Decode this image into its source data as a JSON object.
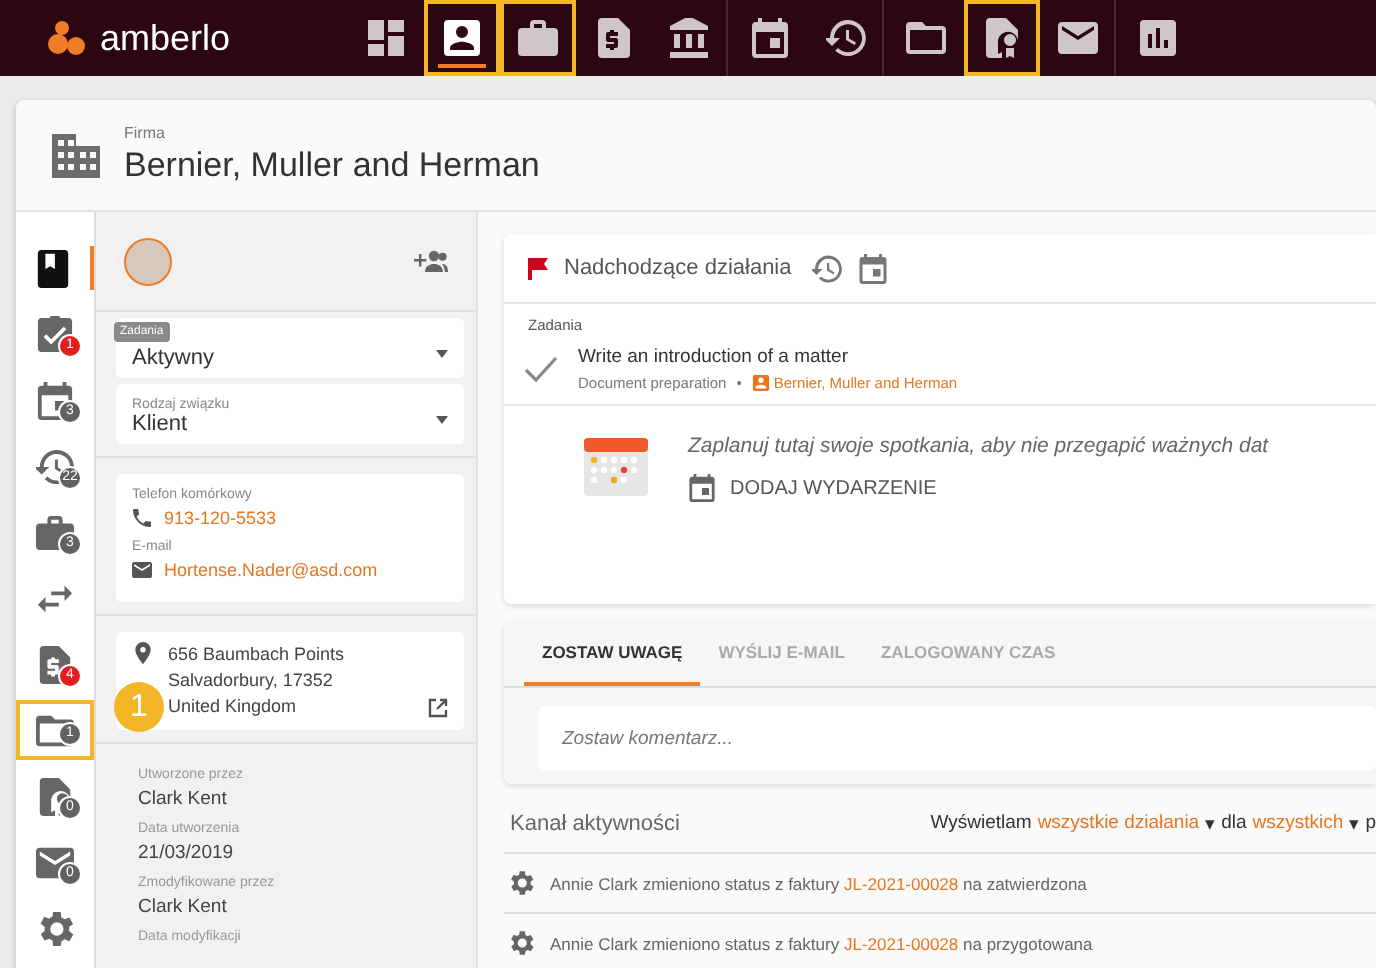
{
  "brand": {
    "name": "amberlo"
  },
  "nav": [
    {
      "kind": "dashboard",
      "selected": false,
      "highlighted": false,
      "divider": false
    },
    {
      "kind": "contact",
      "selected": true,
      "highlighted": true,
      "divider": false
    },
    {
      "kind": "briefcase",
      "selected": false,
      "highlighted": true,
      "divider": false
    },
    {
      "kind": "invoice",
      "selected": false,
      "highlighted": false,
      "divider": false
    },
    {
      "kind": "bank",
      "selected": false,
      "highlighted": false,
      "divider": true
    },
    {
      "kind": "calendar",
      "selected": false,
      "highlighted": false,
      "divider": false
    },
    {
      "kind": "time",
      "selected": false,
      "highlighted": false,
      "divider": true
    },
    {
      "kind": "folder",
      "selected": false,
      "highlighted": false,
      "divider": false
    },
    {
      "kind": "badge",
      "selected": false,
      "highlighted": true,
      "divider": false
    },
    {
      "kind": "mail",
      "selected": false,
      "highlighted": false,
      "divider": true
    },
    {
      "kind": "chart",
      "selected": false,
      "highlighted": false,
      "divider": false
    }
  ],
  "header": {
    "caption": "Firma",
    "title": "Bernier, Muller and Herman"
  },
  "rail": [
    {
      "kind": "book",
      "selected": true,
      "highlighted": false
    },
    {
      "kind": "task",
      "count": "1",
      "color": "#e02020",
      "selected": false,
      "highlighted": false
    },
    {
      "kind": "calendar",
      "count": "3",
      "color": "#616161",
      "selected": false,
      "highlighted": false
    },
    {
      "kind": "time",
      "count": "22",
      "color": "#616161",
      "selected": false,
      "highlighted": false
    },
    {
      "kind": "briefcase",
      "count": "3",
      "color": "#616161",
      "selected": false,
      "highlighted": false
    },
    {
      "kind": "swap",
      "selected": false,
      "highlighted": false
    },
    {
      "kind": "invoice",
      "count": "4",
      "color": "#e02020",
      "selected": false,
      "highlighted": false
    },
    {
      "kind": "folder",
      "count": "1",
      "color": "#616161",
      "selected": false,
      "highlighted": true,
      "step": "1"
    },
    {
      "kind": "badge",
      "count": "0",
      "color": "#616161",
      "selected": false,
      "highlighted": false
    },
    {
      "kind": "mail",
      "count": "0",
      "color": "#616161",
      "selected": false,
      "highlighted": false
    },
    {
      "kind": "gear",
      "selected": false,
      "highlighted": false
    }
  ],
  "details": {
    "tooltip": "Zadania",
    "selects": [
      {
        "value": "Aktywny"
      },
      {
        "label": "Rodzaj związku",
        "value": "Klient"
      }
    ],
    "contacts": [
      {
        "label": "Telefon komórkowy",
        "kind": "phone",
        "value": "913-120-5533"
      },
      {
        "label": "E-mail",
        "kind": "mail",
        "value": "Hortense.Nader@asd.com"
      }
    ],
    "address": [
      "656 Baumbach Points",
      "Salvadorbury, 17352",
      "United Kingdom"
    ],
    "meta": [
      {
        "label": "Utworzone przez",
        "value": "Clark Kent"
      },
      {
        "label": "Data utworzenia",
        "value": "21/03/2019"
      },
      {
        "label": "Zmodyfikowane przez",
        "value": "Clark Kent"
      },
      {
        "label": "Data modyfikacji"
      }
    ]
  },
  "upcoming": {
    "title": "Nadchodzące działania",
    "section": "Zadania",
    "task": {
      "title": "Write an introduction of a matter",
      "category": "Document preparation",
      "separator": "•",
      "company": "Bernier, Muller and Herman"
    },
    "hint": "Zaplanuj tutaj swoje spotkania, aby nie przegapić ważnych dat",
    "add_event": "DODAJ WYDARZENIE"
  },
  "tabs": [
    {
      "label": "ZOSTAW UWAGĘ",
      "selected": true
    },
    {
      "label": "WYŚLIJ E-MAIL",
      "selected": false
    },
    {
      "label": "ZALOGOWANY CZAS",
      "selected": false
    }
  ],
  "comment": {
    "placeholder": "Zostaw komentarz..."
  },
  "activity": {
    "title": "Kanał aktywności",
    "filter": [
      {
        "kind": "text",
        "text": "Wyświetlam"
      },
      {
        "kind": "link",
        "text": "wszystkie działania"
      },
      {
        "kind": "caret",
        "text": "▾"
      },
      {
        "kind": "text",
        "text": "dla"
      },
      {
        "kind": "link",
        "text": "wszystkich"
      },
      {
        "kind": "caret",
        "text": "▾"
      },
      {
        "kind": "text",
        "text": "p"
      }
    ],
    "rows": [
      {
        "who": "Annie Clark",
        "text": "zmieniono status z faktury",
        "ref": "JL-2021-00028",
        "tail": "na zatwierdzona"
      },
      {
        "who": "Annie Clark",
        "text": "zmieniono status z faktury",
        "ref": "JL-2021-00028",
        "tail": "na przygotowana"
      }
    ]
  }
}
